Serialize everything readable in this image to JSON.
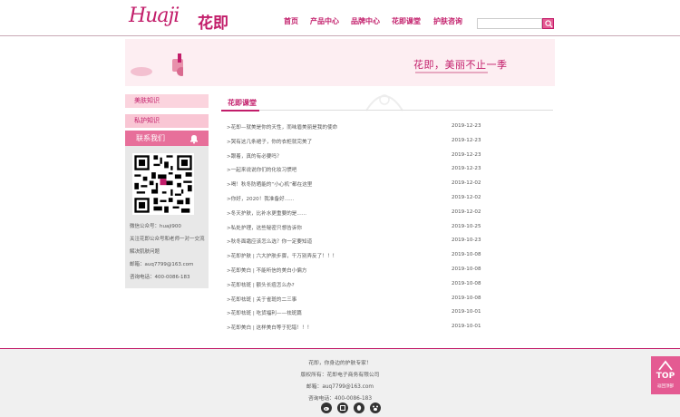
{
  "header": {
    "logo_script": "Huaji",
    "logo_cn": "花即",
    "nav": [
      "首页",
      "产品中心",
      "品牌中心",
      "花即课堂",
      "护肤咨询"
    ],
    "search_placeholder": ""
  },
  "banner": {
    "text": "花即，美丽不止一季"
  },
  "sidebar": {
    "items": [
      "美肤知识",
      "私护知识"
    ],
    "contact_title": "联系我们",
    "contact_lines": [
      "微信公众号：huaji900",
      "关注花即公众号和老师一对一交流",
      "解决肌肤问题",
      "邮箱：auq7799@163.com",
      "咨询电话：400-0086-183"
    ]
  },
  "main": {
    "title": "花即课堂",
    "articles": [
      {
        "title": ">花即—就美是你的天性，而味眉美丽是我的使命",
        "date": "2019-12-23"
      },
      {
        "title": ">哭有这几条裙子，你的衣柜就完美了",
        "date": "2019-12-23"
      },
      {
        "title": ">跟着，真的有必要吗？",
        "date": "2019-12-23"
      },
      {
        "title": ">一起来说说你们的化妆习惯吧",
        "date": "2019-12-23"
      },
      {
        "title": ">喝！秋冬防晒能的“小心机”都在这里",
        "date": "2019-12-02"
      },
      {
        "title": ">你好，2020！我准备好......",
        "date": "2019-12-02"
      },
      {
        "title": ">冬天护肤，比补水更重要的是......",
        "date": "2019-12-02"
      },
      {
        "title": ">私处护理，这些秘密只想告诉你",
        "date": "2019-10-25"
      },
      {
        "title": ">秋冬面霜应该怎么选？你一定要知道",
        "date": "2019-10-23"
      },
      {
        "title": ">花即护肤 | 六大护肤步骤，千万别弄反了！！！",
        "date": "2019-10-08"
      },
      {
        "title": ">花即美白 | 不能听信的美白小偏方",
        "date": "2019-10-08"
      },
      {
        "title": ">花即祛斑 | 额头长痘怎么办?",
        "date": "2019-10-08"
      },
      {
        "title": ">花即祛斑 | 关于雀斑的二三事",
        "date": "2019-10-08"
      },
      {
        "title": ">花即祛斑 | 吃货福利——祛斑篇",
        "date": "2019-10-01"
      },
      {
        "title": ">花即美白 | 这样美白等于犯错！！！",
        "date": "2019-10-01"
      }
    ]
  },
  "footer": {
    "lines": [
      "花即，你身边的护肤专家！",
      "版权所有：花即电子商务有限公司",
      "邮箱：auq7799@163.com",
      "咨询电话：400-0086-183"
    ]
  },
  "back_to_top": {
    "label": "TOP",
    "sub": "返回顶部"
  },
  "colors": {
    "brand": "#c21d6a",
    "accent": "#e45a92",
    "sidebar_item": "#f9c6d4"
  }
}
